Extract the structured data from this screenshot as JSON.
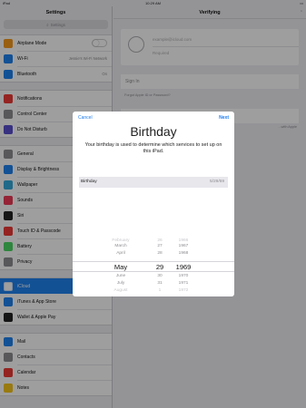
{
  "status": {
    "device": "iPad",
    "time": "10:29 AM"
  },
  "sidebar": {
    "title": "Settings",
    "search_placeholder": "Settings",
    "groups": [
      [
        {
          "label": "Airplane Mode",
          "icon": "airplane-icon",
          "color": "#f79a1c",
          "toggle": true
        },
        {
          "label": "Wi-Fi",
          "icon": "wifi-icon",
          "color": "#1f83f1",
          "value": "Jessie's Wi-Fi Network"
        },
        {
          "label": "Bluetooth",
          "icon": "bluetooth-icon",
          "color": "#1f83f1",
          "value": "On"
        }
      ],
      [
        {
          "label": "Notifications",
          "icon": "notifications-icon",
          "color": "#ef3b36"
        },
        {
          "label": "Control Center",
          "icon": "control-center-icon",
          "color": "#8e8e93"
        },
        {
          "label": "Do Not Disturb",
          "icon": "moon-icon",
          "color": "#5a4fcf"
        }
      ],
      [
        {
          "label": "General",
          "icon": "gear-icon",
          "color": "#8e8e93"
        },
        {
          "label": "Display & Brightness",
          "icon": "brightness-icon",
          "color": "#1f83f1"
        },
        {
          "label": "Wallpaper",
          "icon": "wallpaper-icon",
          "color": "#34aadc"
        },
        {
          "label": "Sounds",
          "icon": "sounds-icon",
          "color": "#ef3b57"
        },
        {
          "label": "Siri",
          "icon": "siri-icon",
          "color": "#222222"
        },
        {
          "label": "Touch ID & Passcode",
          "icon": "fingerprint-icon",
          "color": "#ef3b36"
        },
        {
          "label": "Battery",
          "icon": "battery-icon",
          "color": "#4cd964"
        },
        {
          "label": "Privacy",
          "icon": "privacy-hand-icon",
          "color": "#8e8e93"
        }
      ],
      [
        {
          "label": "iCloud",
          "icon": "icloud-icon",
          "color": "#ffffff",
          "selected": true
        },
        {
          "label": "iTunes & App Store",
          "icon": "app-store-icon",
          "color": "#1f83f1"
        },
        {
          "label": "Wallet & Apple Pay",
          "icon": "wallet-icon",
          "color": "#222222"
        }
      ],
      [
        {
          "label": "Mail",
          "icon": "mail-icon",
          "color": "#1f83f1"
        },
        {
          "label": "Contacts",
          "icon": "contacts-icon",
          "color": "#8e8e93"
        },
        {
          "label": "Calendar",
          "icon": "calendar-icon",
          "color": "#ef3b36"
        },
        {
          "label": "Notes",
          "icon": "notes-icon",
          "color": "#f7c51c"
        }
      ]
    ]
  },
  "pane": {
    "title": "Verifying",
    "email_placeholder": "example@icloud.com",
    "password_placeholder": "Required",
    "sign_in": "Sign In",
    "forgot": "Forgot Apple ID or Password?",
    "note": "...with Apple"
  },
  "modal": {
    "cancel": "Cancel",
    "next": "Next",
    "title": "Birthday",
    "description": "Your birthday is used to determine which services to set up on this iPad.",
    "field_label": "Birthday",
    "field_value": "5/29/69",
    "picker": {
      "rows": [
        {
          "month": "February",
          "day": "26",
          "year": "1966",
          "style": "faint"
        },
        {
          "month": "March",
          "day": "27",
          "year": "1967",
          "style": "mid"
        },
        {
          "month": "April",
          "day": "28",
          "year": "1968",
          "style": "mid"
        },
        {
          "month": "May",
          "day": "29",
          "year": "1969",
          "style": "big"
        },
        {
          "month": "June",
          "day": "30",
          "year": "1970",
          "style": "mid"
        },
        {
          "month": "July",
          "day": "31",
          "year": "1971",
          "style": "mid"
        },
        {
          "month": "August",
          "day": "1",
          "year": "1972",
          "style": "faint"
        }
      ]
    }
  }
}
